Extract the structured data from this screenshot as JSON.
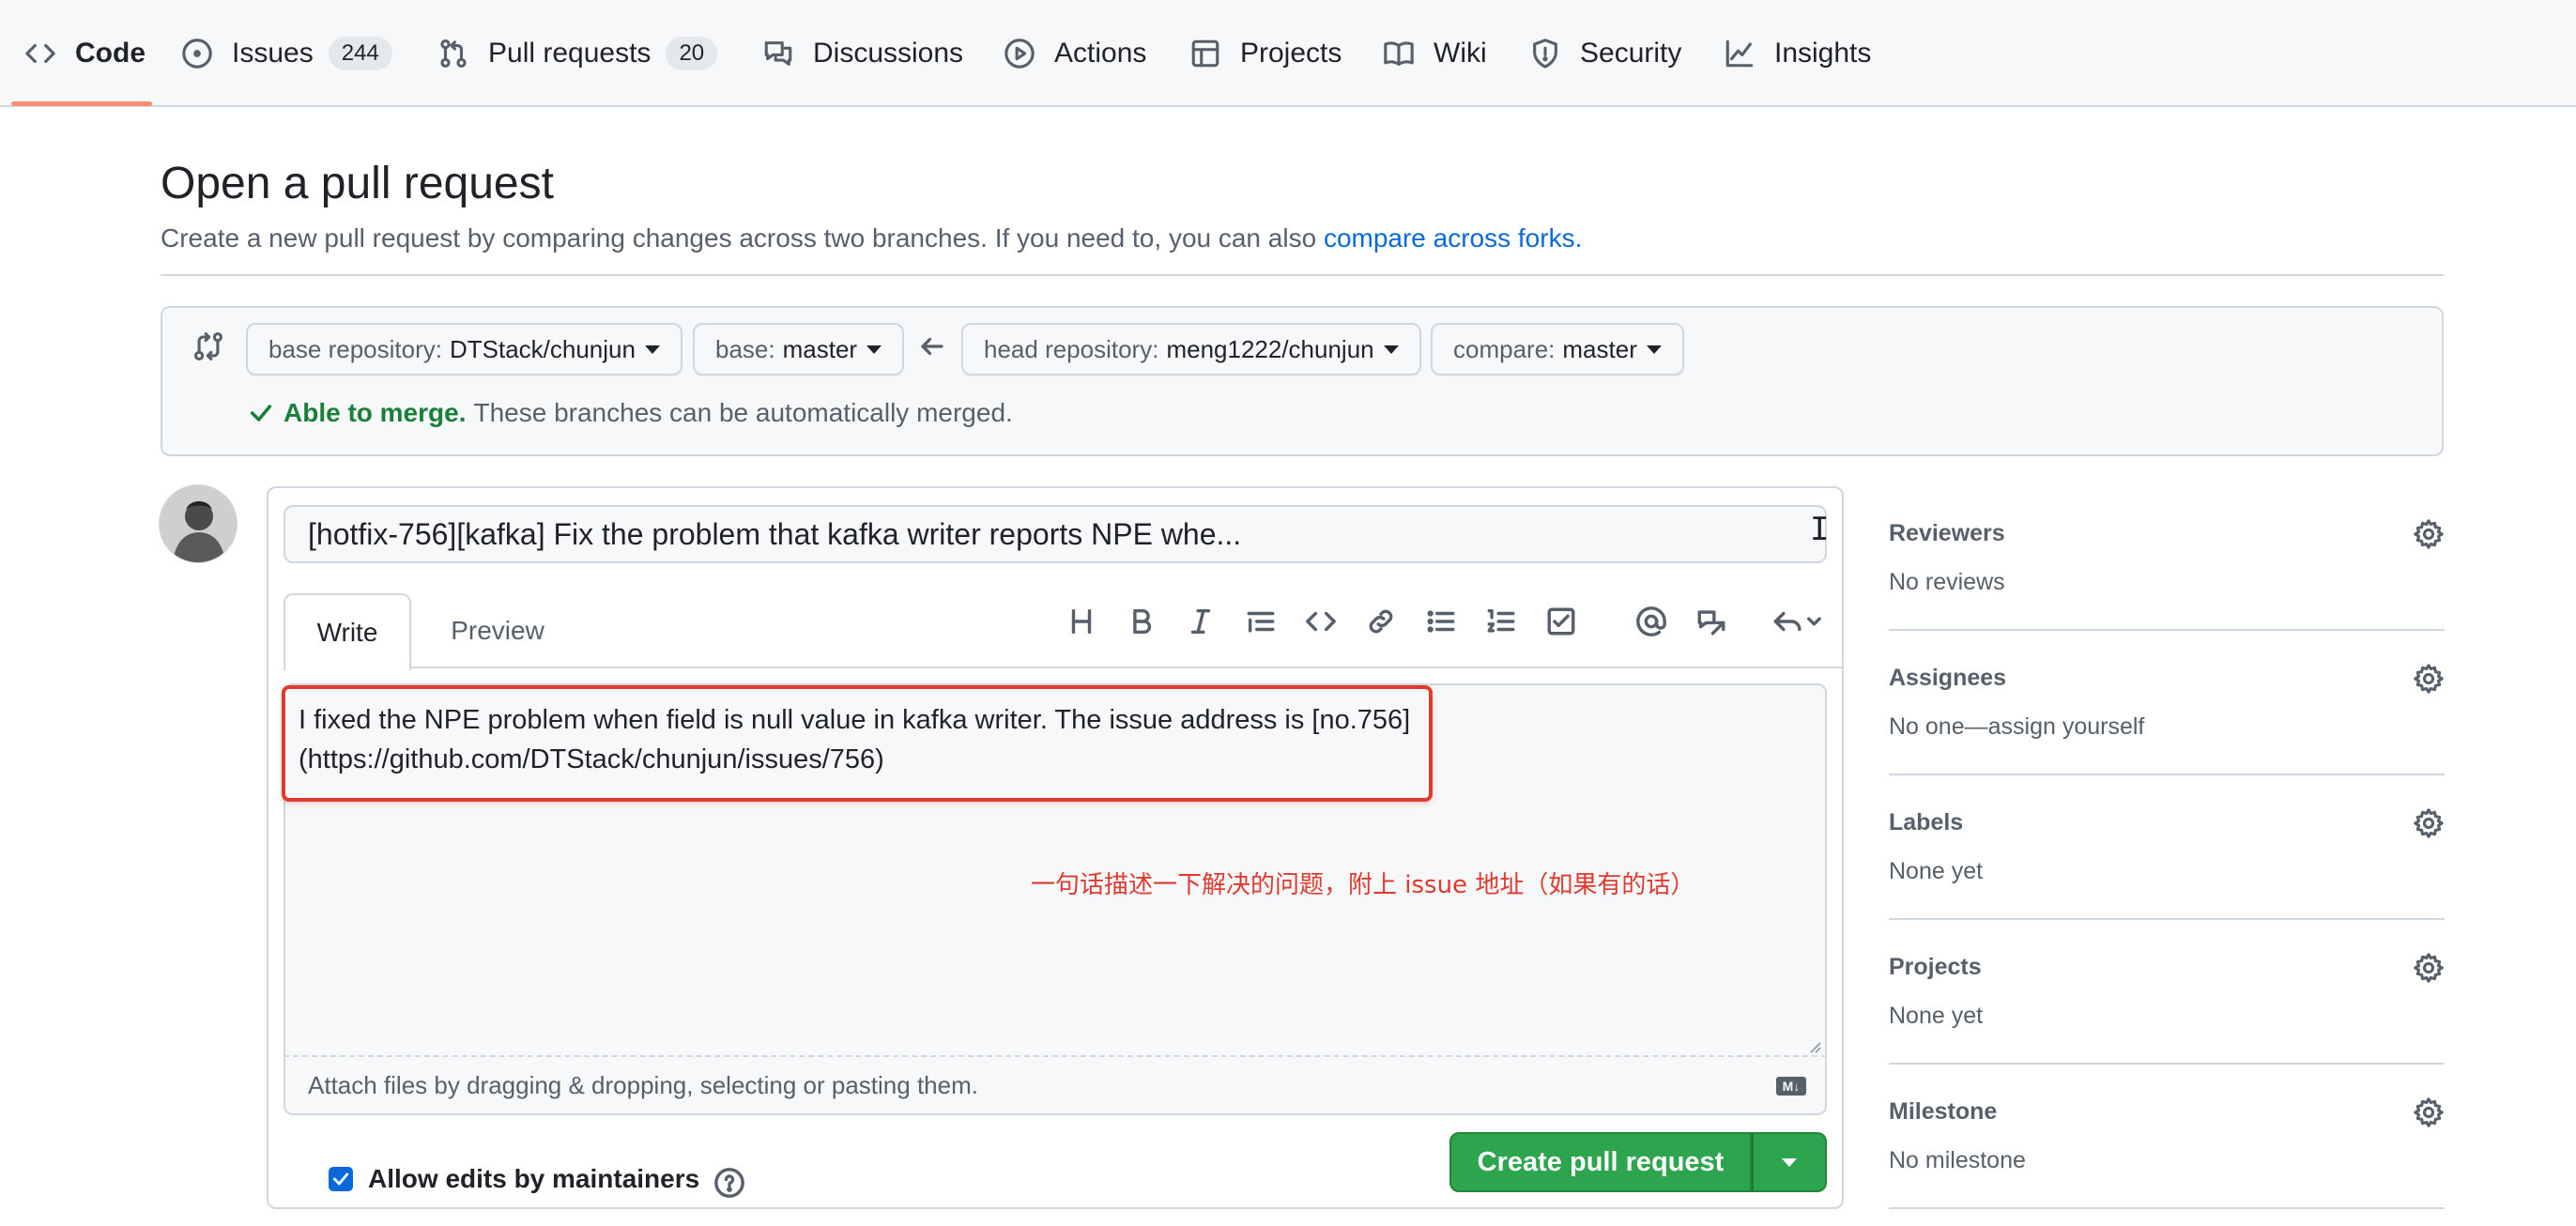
{
  "repo_nav": {
    "tabs": [
      {
        "label": "Code",
        "icon": "code-icon"
      },
      {
        "label": "Issues",
        "icon": "issue-opened-icon",
        "count": "244"
      },
      {
        "label": "Pull requests",
        "icon": "git-pull-request-icon",
        "count": "20"
      },
      {
        "label": "Discussions",
        "icon": "comment-discussion-icon"
      },
      {
        "label": "Actions",
        "icon": "play-icon"
      },
      {
        "label": "Projects",
        "icon": "table-icon"
      },
      {
        "label": "Wiki",
        "icon": "book-icon"
      },
      {
        "label": "Security",
        "icon": "shield-icon"
      },
      {
        "label": "Insights",
        "icon": "graph-icon"
      }
    ],
    "selected": "Code"
  },
  "header": {
    "title": "Open a pull request",
    "description": "Create a new pull request by comparing changes across two branches. If you need to, you can also ",
    "link_text": "compare across forks."
  },
  "range": {
    "base_repo_label": "base repository:",
    "base_repo_value": "DTStack/chunjun",
    "base_label": "base:",
    "base_value": "master",
    "head_repo_label": "head repository:",
    "head_repo_value": "meng1222/chunjun",
    "compare_label": "compare:",
    "compare_value": "master",
    "merge_status_strong": "Able to merge.",
    "merge_status_text": "These branches can be automatically merged."
  },
  "form": {
    "title_value": "[hotfix-756][kafka] Fix the problem that kafka writer reports NPE whe...",
    "tabs": {
      "write": "Write",
      "preview": "Preview"
    },
    "toolbar": [
      "heading-icon",
      "bold-icon",
      "italic-icon",
      "quote-icon",
      "code-icon",
      "link-icon",
      "unordered-list-icon",
      "ordered-list-icon",
      "tasklist-icon",
      "mention-icon",
      "cross-reference-icon",
      "reply-icon"
    ],
    "body_line1": "I fixed the NPE problem when field is null value in kafka writer. The issue address is [no.756]",
    "body_line2": "(https://github.com/DTStack/chunjun/issues/756)",
    "annotation": "一句话描述一下解决的问题，附上 issue 地址（如果有的话）",
    "attach_text": "Attach files by dragging & dropping, selecting or pasting them.",
    "md_badge": "M↓",
    "allow_edits_label": "Allow edits by maintainers",
    "allow_edits_checked": true,
    "create_button": "Create pull request"
  },
  "sidebar": {
    "reviewers_title": "Reviewers",
    "reviewers_value": "No reviews",
    "assignees_title": "Assignees",
    "assignees_value": "No one—assign yourself",
    "labels_title": "Labels",
    "labels_value": "None yet",
    "projects_title": "Projects",
    "projects_value": "None yet",
    "milestone_title": "Milestone",
    "milestone_value": "No milestone"
  },
  "colors": {
    "accent_blue": "#0969da",
    "success_green": "#2da44e",
    "annotation_red": "#e03a2f",
    "nav_underline": "#fd8c73"
  }
}
